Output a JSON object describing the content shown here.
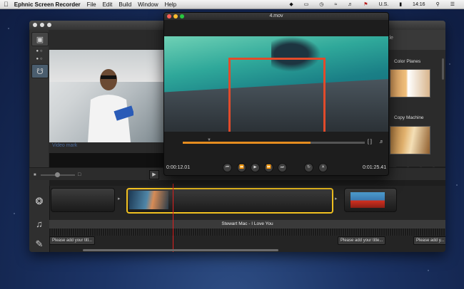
{
  "menubar": {
    "apple": "",
    "app_name": "Ephnic Screen Recorder",
    "menus": [
      "File",
      "Edit",
      "Build",
      "Window",
      "Help"
    ],
    "locale": "U.S.",
    "time": "14:16"
  },
  "player": {
    "title": "4.mov",
    "current_time": "0:00:12.01",
    "total_time": "0:01:25.41",
    "progress": 0.7
  },
  "preview": {
    "watermark": "Video mark"
  },
  "effects_panel": {
    "header_fragment": "itle",
    "items": [
      {
        "label": "Color Planes"
      },
      {
        "label": "Copy Machine"
      }
    ]
  },
  "timeline": {
    "audio_track_title": "Stewart Mac - I Love You",
    "title_placeholders": [
      "Please add your titl...",
      "Please add your title...",
      "Please add y..."
    ]
  },
  "colors": {
    "accent_orange": "#e58c1f",
    "selection_yellow": "#f0c020",
    "playhead_red": "#e02020"
  }
}
